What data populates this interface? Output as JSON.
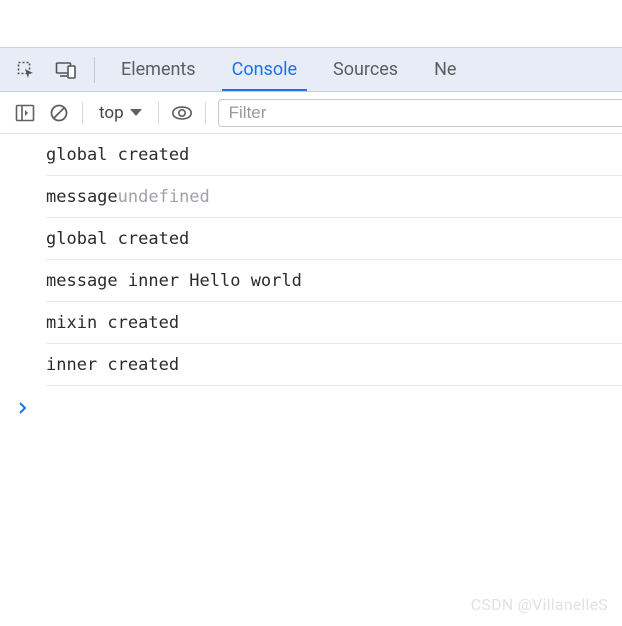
{
  "tabs": {
    "elements": "Elements",
    "console": "Console",
    "sources": "Sources",
    "network_partial": "Ne"
  },
  "toolbar": {
    "context": "top",
    "filter_placeholder": "Filter"
  },
  "logs": [
    {
      "parts": [
        {
          "text": "global created",
          "cls": "log-text"
        }
      ]
    },
    {
      "parts": [
        {
          "text": "message ",
          "cls": "log-text"
        },
        {
          "text": "undefined",
          "cls": "log-undef"
        }
      ]
    },
    {
      "parts": [
        {
          "text": "global created",
          "cls": "log-text"
        }
      ]
    },
    {
      "parts": [
        {
          "text": "message inner Hello world",
          "cls": "log-text"
        }
      ]
    },
    {
      "parts": [
        {
          "text": "mixin created",
          "cls": "log-text"
        }
      ]
    },
    {
      "parts": [
        {
          "text": "inner created",
          "cls": "log-text"
        }
      ]
    }
  ],
  "watermark": "CSDN @VillanelleS"
}
